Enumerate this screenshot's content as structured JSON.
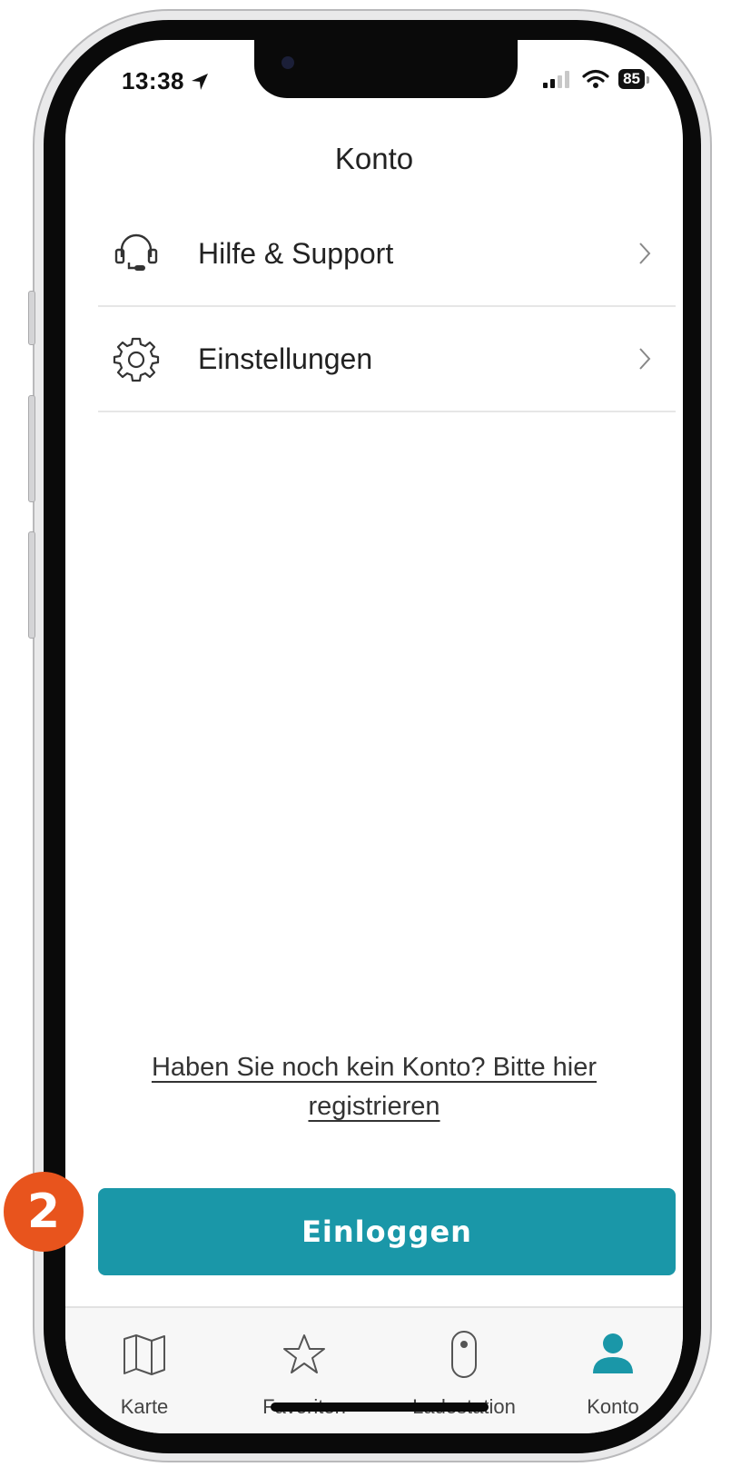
{
  "status_bar": {
    "time": "13:38",
    "battery": "85"
  },
  "header": {
    "title": "Konto"
  },
  "menu": {
    "items": [
      {
        "label": "Hilfe & Support",
        "icon": "headset-icon"
      },
      {
        "label": "Einstellungen",
        "icon": "gear-icon"
      }
    ]
  },
  "register": {
    "line1": "Haben Sie noch kein Konto? Bitte hier",
    "line2": "registrieren"
  },
  "login_button": {
    "label": "Einloggen"
  },
  "step_badge": {
    "number": "2"
  },
  "tabbar": {
    "tabs": [
      {
        "label": "Karte",
        "icon": "map-icon",
        "active": false
      },
      {
        "label": "Favoriten",
        "icon": "star-icon",
        "active": false
      },
      {
        "label": "Ladestation",
        "icon": "charger-icon",
        "active": false
      },
      {
        "label": "Konto",
        "icon": "user-icon",
        "active": true
      }
    ]
  },
  "colors": {
    "accent": "#1a97a8",
    "badge": "#e8541d",
    "active_tab": "#1a97a8"
  }
}
